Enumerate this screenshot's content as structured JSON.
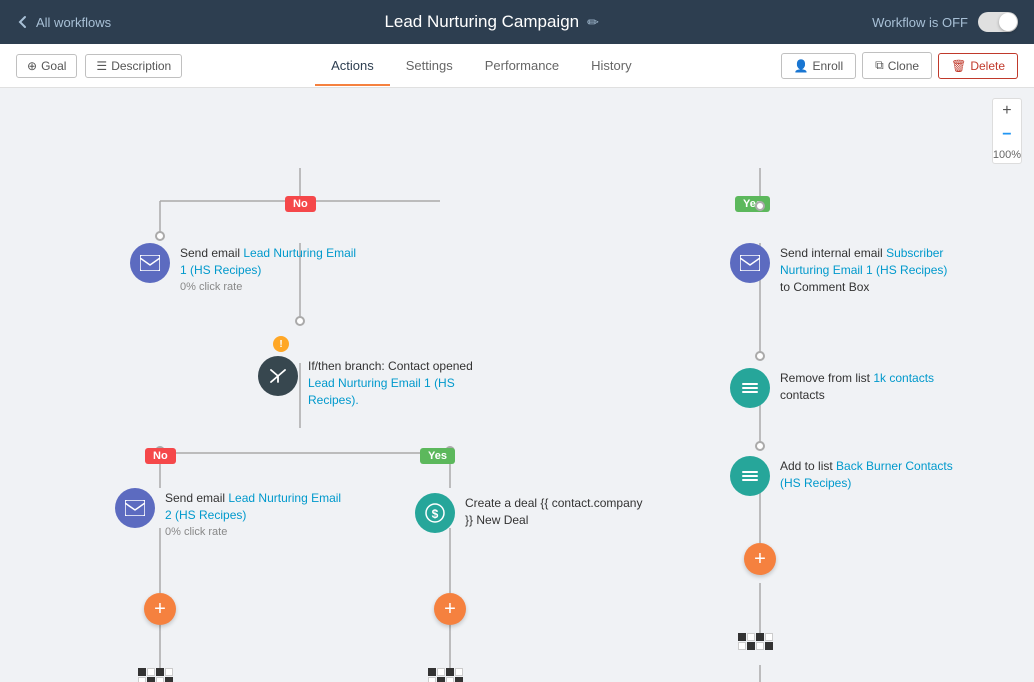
{
  "header": {
    "back_label": "All workflows",
    "title": "Lead Nurturing Campaign",
    "workflow_status_label": "Workflow is OFF"
  },
  "toolbar": {
    "goal_label": "Goal",
    "description_label": "Description",
    "tabs": [
      {
        "label": "Actions",
        "active": true
      },
      {
        "label": "Settings",
        "active": false
      },
      {
        "label": "Performance",
        "active": false
      },
      {
        "label": "History",
        "active": false
      }
    ],
    "enroll_label": "Enroll",
    "clone_label": "Clone",
    "delete_label": "Delete"
  },
  "zoom": {
    "plus_label": "+",
    "minus_label": "−",
    "level": "100%"
  },
  "nodes": {
    "send_email_1": {
      "title_prefix": "Send email ",
      "email_link": "Lead Nurturing Email 1 (HS Recipes)",
      "meta": "0% click rate"
    },
    "send_internal_email": {
      "title_prefix": "Send internal email ",
      "email_link": "Subscriber Nurturing Email 1 (HS Recipes)",
      "title_suffix": " to Comment Box"
    },
    "branch": {
      "title_prefix": "If/then branch: Contact opened ",
      "link": "Lead Nurturing Email 1 (HS Recipes).",
      "warning": true
    },
    "remove_from_list": {
      "title_prefix": "Remove from list ",
      "link": "1k contacts"
    },
    "add_to_list": {
      "title_prefix": "Add to list ",
      "link": "Back Burner Contacts (HS Recipes)"
    },
    "send_email_2": {
      "title_prefix": "Send email ",
      "email_link": "Lead Nurturing Email 2 (HS Recipes)",
      "meta": "0% click rate"
    },
    "create_deal": {
      "title": "Create a deal {{ contact.company }} New Deal"
    }
  },
  "branch_labels": {
    "no": "No",
    "yes": "Yes"
  }
}
